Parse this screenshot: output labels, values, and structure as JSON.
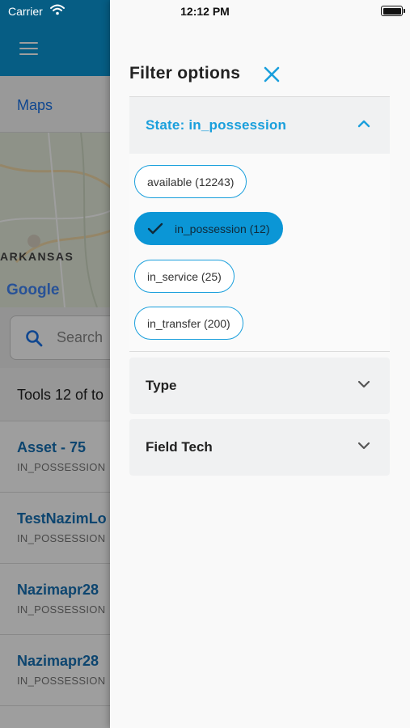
{
  "status_bar": {
    "carrier": "Carrier",
    "time": "12:12 PM"
  },
  "background": {
    "maps_link": "Maps",
    "map_label": "ARKANSAS",
    "google_logo": "Google",
    "search_placeholder": "Search",
    "tools_text": "Tools 12 of to",
    "items": [
      {
        "title": "Asset - 75",
        "subtitle": "IN_POSSESSION"
      },
      {
        "title": "TestNazimLo",
        "subtitle": "IN_POSSESSION"
      },
      {
        "title": "Nazimapr28",
        "subtitle": "IN_POSSESSION"
      },
      {
        "title": "Nazimapr28",
        "subtitle": "IN_POSSESSION"
      }
    ]
  },
  "drawer": {
    "title": "Filter options",
    "state": {
      "header": "State: in_possession",
      "chips": [
        {
          "label": "available (12243)",
          "selected": false
        },
        {
          "label": "in_possession (12)",
          "selected": true
        },
        {
          "label": "in_service (25)",
          "selected": false
        },
        {
          "label": "in_transfer (200)",
          "selected": false
        }
      ]
    },
    "type_label": "Type",
    "field_tech_label": "Field Tech"
  },
  "colors": {
    "accent": "#0b96d6",
    "accent_text": "#1a9fdc",
    "header_blue": "#0b96d6"
  },
  "icons": [
    "wifi-icon",
    "battery-icon",
    "hamburger-icon",
    "search-icon",
    "close-icon",
    "chevron-up-icon",
    "chevron-down-icon",
    "check-icon"
  ]
}
